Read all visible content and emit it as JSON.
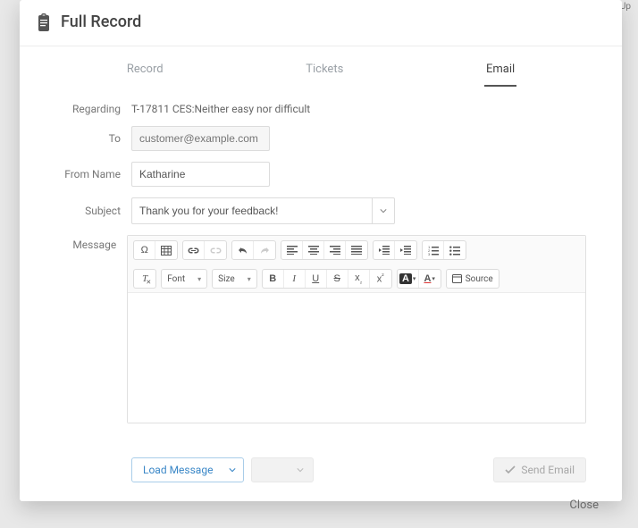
{
  "bgFragment": "‹ › Page Up",
  "header": {
    "title": "Full Record"
  },
  "tabs": {
    "record": "Record",
    "tickets": "Tickets",
    "email": "Email",
    "active": "email"
  },
  "form": {
    "labels": {
      "regarding": "Regarding",
      "to": "To",
      "fromName": "From Name",
      "subject": "Subject",
      "message": "Message"
    },
    "regarding": "T-17811 CES:Neither easy nor difficult",
    "to": {
      "value": "",
      "placeholder": "customer@example.com"
    },
    "fromName": "Katharine",
    "subject": "Thank you for your feedback!"
  },
  "toolbar": {
    "fontLabel": "Font",
    "sizeLabel": "Size",
    "sourceLabel": "Source"
  },
  "actions": {
    "loadMessage": "Load Message",
    "sendEmail": "Send Email",
    "close": "Close"
  }
}
